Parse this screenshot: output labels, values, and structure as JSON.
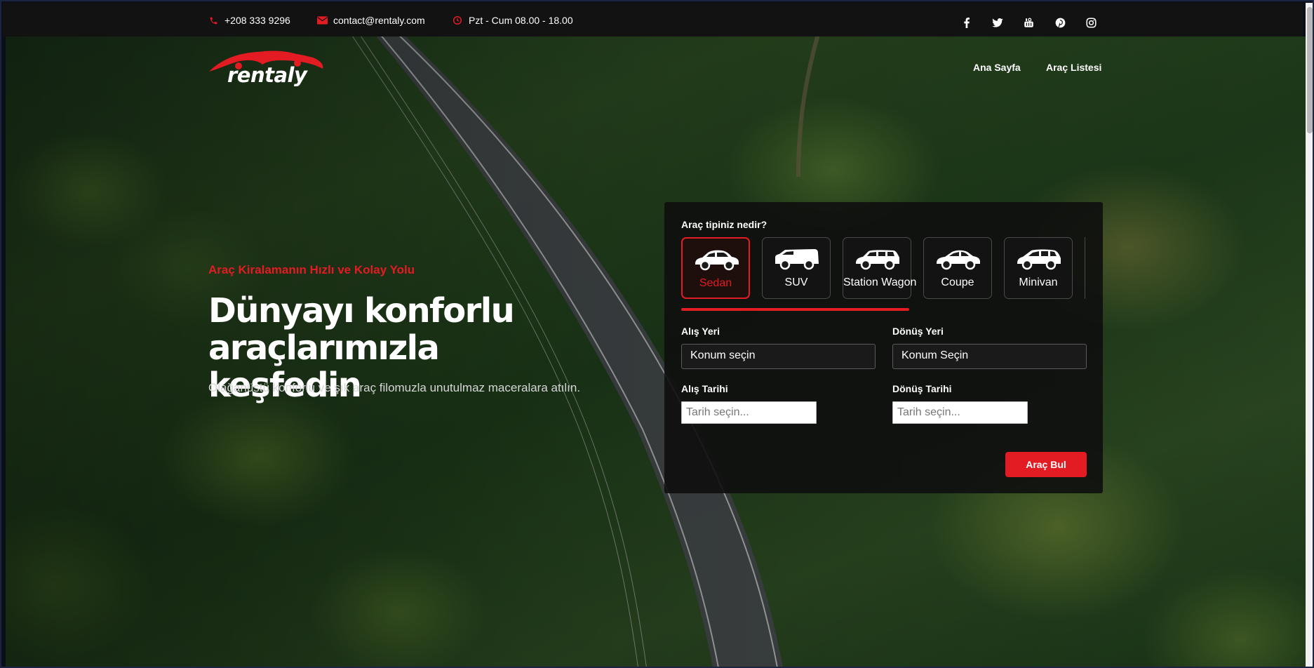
{
  "topbar": {
    "phone": "+208 333 9296",
    "email": "contact@rentaly.com",
    "hours": "Pzt - Cum 08.00 - 18.00",
    "social": [
      "facebook-icon",
      "twitter-icon",
      "youtube-icon",
      "pinterest-icon",
      "instagram-icon"
    ]
  },
  "brand": {
    "name": "rentaly"
  },
  "nav": {
    "items": [
      "Ana Sayfa",
      "Araç Listesi"
    ]
  },
  "hero": {
    "kicker": "Araç Kiralamanın Hızlı ve Kolay Yolu",
    "headline_line1": "Dünyayı konforlu",
    "headline_line2": "araçlarımızla keşfedin",
    "subtext": "Olağanüstü konforlu ve şık araç filomuzla unutulmaz maceralara atılın."
  },
  "search": {
    "question": "Araç tipiniz nedir?",
    "types": [
      "Sedan",
      "SUV",
      "Station Wagon",
      "Coupe",
      "Minivan"
    ],
    "selected_type": "Sedan",
    "pickup_label": "Alış Yeri",
    "pickup_value": "Konum seçin",
    "dropoff_label": "Dönüş Yeri",
    "dropoff_value": "Konum Seçin",
    "pickup_date_label": "Alış Tarihi",
    "pickup_date_placeholder": "Tarih seçin...",
    "dropoff_date_label": "Dönüş Tarihi",
    "dropoff_date_placeholder": "Tarih seçin...",
    "submit_label": "Araç Bul"
  },
  "colors": {
    "accent": "#e31b23",
    "topbar_bg": "#121212",
    "panel_bg": "#0e0e0e"
  }
}
